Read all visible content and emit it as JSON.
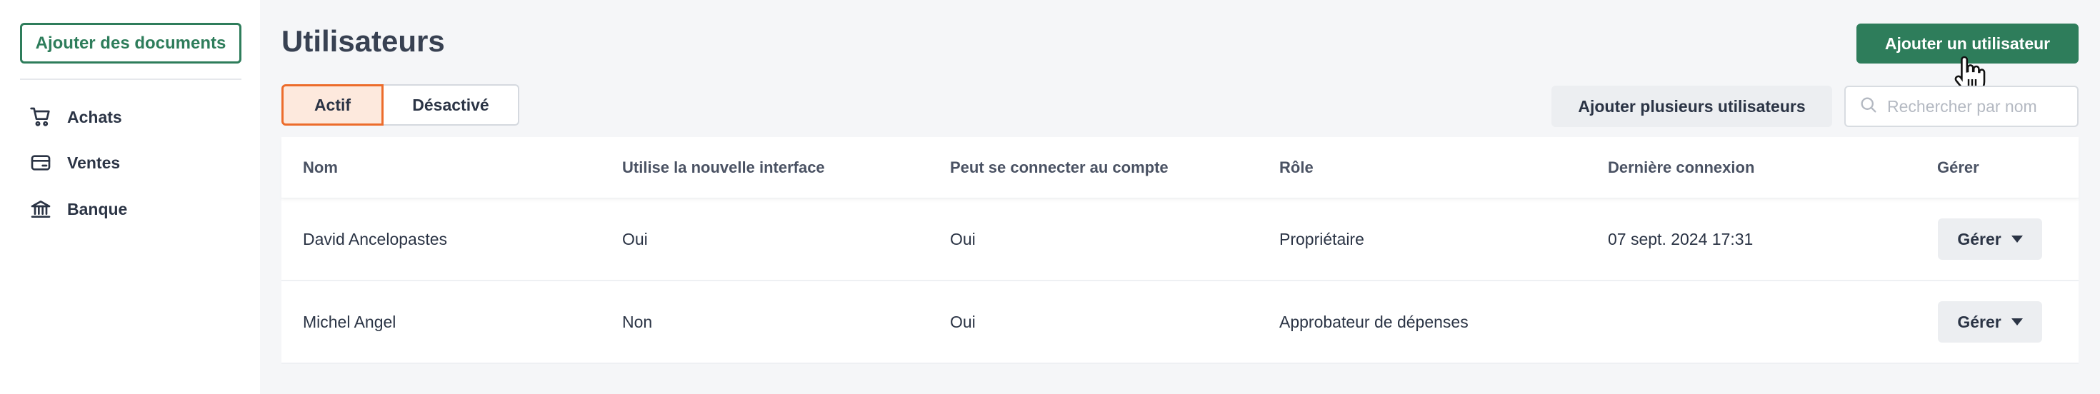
{
  "sidebar": {
    "add_documents_label": "Ajouter des documents",
    "items": [
      {
        "label": "Achats",
        "icon": "cart-icon"
      },
      {
        "label": "Ventes",
        "icon": "card-icon"
      },
      {
        "label": "Banque",
        "icon": "bank-icon"
      }
    ]
  },
  "header": {
    "title": "Utilisateurs",
    "add_user_label": "Ajouter un utilisateur"
  },
  "filters": {
    "active_label": "Actif",
    "disabled_label": "Désactivé",
    "selected": "Actif"
  },
  "toolbar": {
    "add_multiple_label": "Ajouter plusieurs utilisateurs",
    "search_placeholder": "Rechercher par nom"
  },
  "table": {
    "columns": [
      "Nom",
      "Utilise la nouvelle interface",
      "Peut se connecter au compte",
      "Rôle",
      "Dernière connexion",
      "Gérer"
    ],
    "rows": [
      {
        "name": "David Ancelopastes",
        "new_interface": "Oui",
        "can_login": "Oui",
        "role": "Propriétaire",
        "last_login": "07 sept. 2024 17:31",
        "manage_label": "Gérer"
      },
      {
        "name": "Michel Angel",
        "new_interface": "Non",
        "can_login": "Oui",
        "role": "Approbateur de dépenses",
        "last_login": "",
        "manage_label": "Gérer"
      }
    ]
  },
  "colors": {
    "primary": "#2e7d5b",
    "active_filter_border": "#ec6c2b",
    "active_filter_bg": "#fde9dd"
  }
}
